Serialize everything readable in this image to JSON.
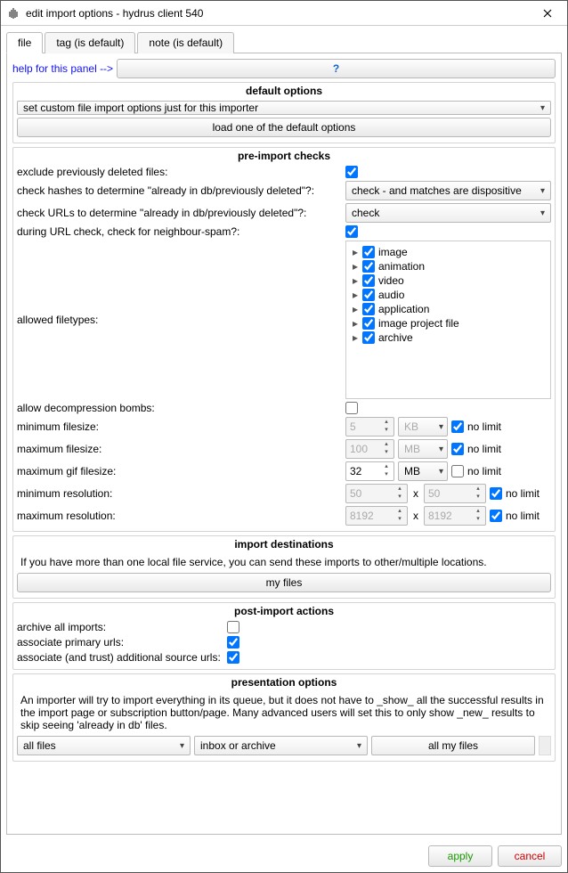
{
  "window": {
    "title": "edit import options - hydrus client 540"
  },
  "tabs": {
    "file": "file",
    "tag": "tag (is default)",
    "note": "note (is default)"
  },
  "help_label": "help for this panel -->",
  "sections": {
    "default_options": {
      "header": "default options",
      "select": "set custom file import options just for this importer",
      "load_button": "load one of the default options"
    },
    "preimport": {
      "header": "pre-import checks",
      "exclude_label": "exclude previously deleted files:",
      "check_hashes_label": "check hashes to determine \"already in db/previously deleted\"?:",
      "check_hashes_value": "check - and matches are dispositive",
      "check_urls_label": "check URLs to determine \"already in db/previously deleted\"?:",
      "check_urls_value": "check",
      "neighbour_label": "during URL check, check for neighbour-spam?:",
      "filetypes_label": "allowed filetypes:",
      "filetypes": [
        "image",
        "animation",
        "video",
        "audio",
        "application",
        "image project file",
        "archive"
      ],
      "allow_decomp": "allow decompression bombs:",
      "min_fs_label": "minimum filesize:",
      "min_fs_val": "5",
      "min_fs_unit": "KB",
      "max_fs_label": "maximum filesize:",
      "max_fs_val": "100",
      "max_fs_unit": "MB",
      "max_gif_label": "maximum gif filesize:",
      "max_gif_val": "32",
      "max_gif_unit": "MB",
      "min_res_label": "minimum resolution:",
      "min_res_w": "50",
      "min_res_h": "50",
      "max_res_label": "maximum resolution:",
      "max_res_w": "8192",
      "max_res_h": "8192",
      "no_limit": "no limit",
      "x": "x"
    },
    "dest": {
      "header": "import destinations",
      "desc": "If you have more than one local file service, you can send these imports to other/multiple locations.",
      "button": "my files"
    },
    "post": {
      "header": "post-import actions",
      "archive": "archive all imports:",
      "primary": "associate primary urls:",
      "additional": "associate (and trust) additional source urls:"
    },
    "presentation": {
      "header": "presentation options",
      "desc": "An importer will try to import everything in its queue, but it does not have to _show_ all the successful results in the import page or subscription button/page. Many advanced users will set this to only show _new_ results to skip seeing 'already in db' files.",
      "c1": "all files",
      "c2": "inbox or archive",
      "c3": "all my files"
    }
  },
  "footer": {
    "apply": "apply",
    "cancel": "cancel"
  }
}
